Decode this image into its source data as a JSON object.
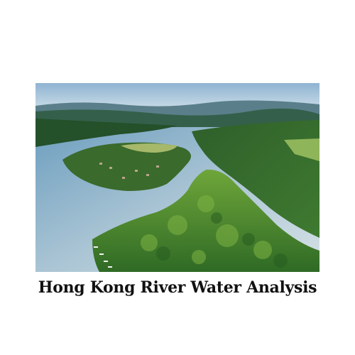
{
  "caption": {
    "title": "Hong Kong River Water Analysis"
  },
  "image": {
    "icon": "river-landscape-photo",
    "colors": {
      "sky": "#a9c6dc",
      "water": "#7fa9c4",
      "forest_dark": "#1f4a22",
      "forest_light": "#5d9a32",
      "field": "#a6b86a"
    }
  }
}
